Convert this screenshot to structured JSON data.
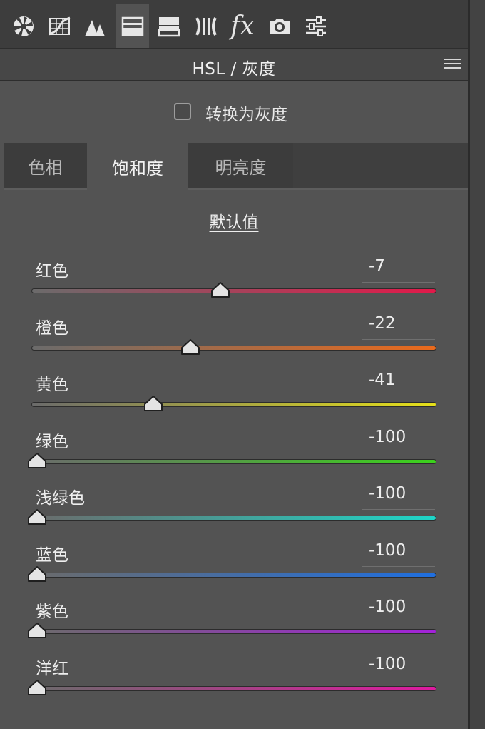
{
  "toolbar": {
    "tools": [
      {
        "name": "basic-panel-icon",
        "active": false
      },
      {
        "name": "tone-curve-icon",
        "active": false
      },
      {
        "name": "detail-icon",
        "active": false
      },
      {
        "name": "hsl-panel-icon",
        "active": true
      },
      {
        "name": "split-toning-icon",
        "active": false
      },
      {
        "name": "lens-corrections-icon",
        "active": false
      },
      {
        "name": "effects-fx-icon",
        "active": false
      },
      {
        "name": "camera-calibration-icon",
        "active": false
      },
      {
        "name": "presets-sliders-icon",
        "active": false
      }
    ],
    "fx_label": "fx"
  },
  "header": {
    "title": "HSL / 灰度",
    "menu_icon": "panel-menu-icon"
  },
  "grayscale": {
    "label": "转换为灰度",
    "checked": false
  },
  "tabs": [
    {
      "label": "色相",
      "active": false
    },
    {
      "label": "饱和度",
      "active": true
    },
    {
      "label": "明亮度",
      "active": false
    }
  ],
  "defaults_link": "默认值",
  "sliders": [
    {
      "label": "红色",
      "value": "-7",
      "level": -7,
      "colors": [
        "#6b6b6b",
        "#e2194a"
      ]
    },
    {
      "label": "橙色",
      "value": "-22",
      "level": -22,
      "colors": [
        "#6b6b6b",
        "#ea6a1c"
      ]
    },
    {
      "label": "黄色",
      "value": "-41",
      "level": -41,
      "colors": [
        "#6b6b6b",
        "#e6e01a"
      ]
    },
    {
      "label": "绿色",
      "value": "-100",
      "level": -100,
      "colors": [
        "#6b6b6b",
        "#3bd21c"
      ]
    },
    {
      "label": "浅绿色",
      "value": "-100",
      "level": -100,
      "colors": [
        "#6b6b6b",
        "#1ed6c8"
      ]
    },
    {
      "label": "蓝色",
      "value": "-100",
      "level": -100,
      "colors": [
        "#6b6b6b",
        "#1f6fe0"
      ]
    },
    {
      "label": "紫色",
      "value": "-100",
      "level": -100,
      "colors": [
        "#6b6b6b",
        "#a322d9"
      ]
    },
    {
      "label": "洋红",
      "value": "-100",
      "level": -100,
      "colors": [
        "#6b6b6b",
        "#de1aa0"
      ]
    }
  ]
}
